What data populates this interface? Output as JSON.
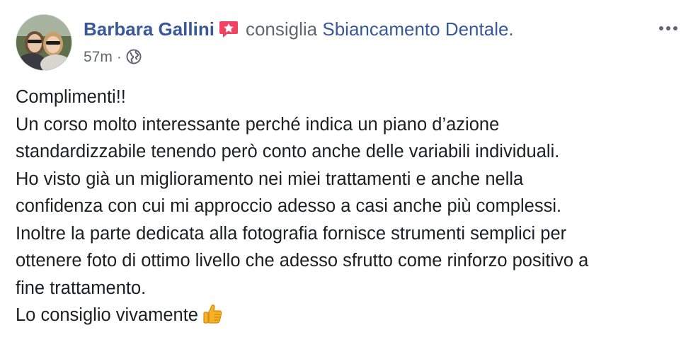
{
  "post": {
    "author": "Barbara Gallini",
    "action": "consiglia",
    "page": "Sbiancamento Dentale.",
    "time": "57m",
    "separator": "·",
    "privacy_icon": "globe-icon",
    "recommend_icon": "recommend-star-icon",
    "more_icon": "more-options-icon",
    "lines": [
      "Complimenti!!",
      "Un corso molto interessante perché indica un piano d’azione",
      "standardizzabile tenendo però conto anche delle variabili individuali.",
      "Ho visto già un miglioramento nei miei trattamenti e anche nella",
      "confidenza con cui mi approccio adesso a casi anche più complessi.",
      "Inoltre la parte dedicata alla fotografia fornisce strumenti semplici per",
      "ottenere foto di ottimo livello che adesso sfrutto come rinforzo positivo a",
      "fine trattamento.",
      "Lo consiglio vivamente"
    ],
    "closing_emoji_icon": "thumbs-up-icon"
  },
  "colors": {
    "link": "#385898",
    "secondary": "#606770",
    "text": "#1c1e21",
    "recommend": "#f3425f",
    "thumb": "#f7b125"
  }
}
